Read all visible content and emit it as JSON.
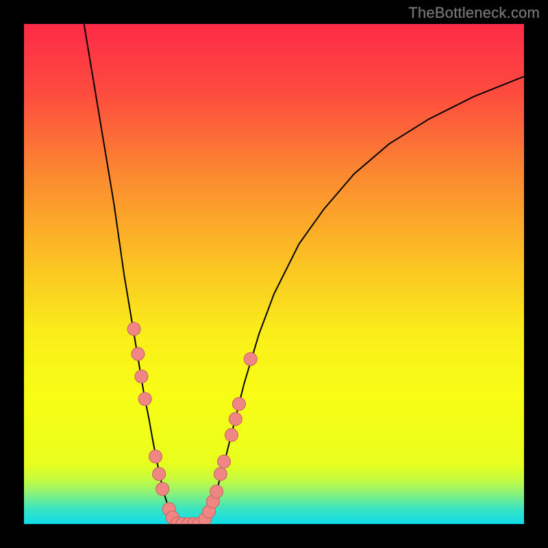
{
  "watermark": "TheBottleneck.com",
  "colors": {
    "frame": "#000000",
    "curve": "#000000",
    "marker_fill": "#ef8683",
    "marker_stroke": "#c46864"
  },
  "chart_data": {
    "type": "line",
    "title": "",
    "xlabel": "",
    "ylabel": "",
    "xlim": [
      0,
      100
    ],
    "ylim": [
      0,
      100
    ],
    "gradient_stops": [
      {
        "offset": 0,
        "color": "#fd2b47"
      },
      {
        "offset": 14,
        "color": "#fd4c3f"
      },
      {
        "offset": 30,
        "color": "#fc8931"
      },
      {
        "offset": 48,
        "color": "#fbc323"
      },
      {
        "offset": 62,
        "color": "#faee1a"
      },
      {
        "offset": 74,
        "color": "#f8fd16"
      },
      {
        "offset": 83,
        "color": "#effe19"
      },
      {
        "offset": 88,
        "color": "#e7fe1e"
      },
      {
        "offset": 91,
        "color": "#c7fb3e"
      },
      {
        "offset": 93,
        "color": "#a0f565"
      },
      {
        "offset": 95,
        "color": "#6ded94"
      },
      {
        "offset": 97,
        "color": "#39e4c2"
      },
      {
        "offset": 100,
        "color": "#0fdce7"
      }
    ],
    "series": [
      {
        "name": "left-branch",
        "x": [
          12,
          13.5,
          15,
          16.5,
          18,
          19,
          20,
          21,
          22,
          23,
          24,
          25,
          25.8,
          26.6,
          27.4,
          28.2,
          29,
          29.7,
          30.3
        ],
        "y": [
          100,
          91,
          82,
          73,
          64,
          57,
          50,
          44,
          38,
          32,
          26,
          21,
          16.5,
          12.4,
          8.7,
          5.5,
          3.0,
          1.3,
          0.3
        ]
      },
      {
        "name": "valley",
        "x": [
          30.3,
          31,
          32,
          33,
          34,
          35,
          35.7
        ],
        "y": [
          0.3,
          0,
          0,
          0,
          0,
          0,
          0.3
        ]
      },
      {
        "name": "right-branch",
        "x": [
          35.7,
          36.5,
          37.3,
          38.5,
          40,
          42,
          44,
          47,
          50,
          55,
          60,
          66,
          73,
          81,
          90,
          100
        ],
        "y": [
          0.3,
          1.5,
          3.2,
          6.5,
          12,
          20,
          28,
          38,
          46,
          56,
          63,
          70,
          76,
          81,
          85.5,
          89.5
        ]
      }
    ],
    "markers": [
      {
        "x": 22.0,
        "y": 39.0,
        "r": 1.3
      },
      {
        "x": 22.8,
        "y": 34.0,
        "r": 1.3
      },
      {
        "x": 23.5,
        "y": 29.5,
        "r": 1.3
      },
      {
        "x": 24.2,
        "y": 25.0,
        "r": 1.3
      },
      {
        "x": 26.3,
        "y": 13.5,
        "r": 1.3
      },
      {
        "x": 27.0,
        "y": 10.0,
        "r": 1.3
      },
      {
        "x": 27.7,
        "y": 7.0,
        "r": 1.3
      },
      {
        "x": 29.0,
        "y": 3.0,
        "r": 1.3
      },
      {
        "x": 29.7,
        "y": 1.3,
        "r": 1.3
      },
      {
        "x": 30.7,
        "y": 0.1,
        "r": 1.3
      },
      {
        "x": 31.7,
        "y": 0.0,
        "r": 1.3
      },
      {
        "x": 32.9,
        "y": 0.0,
        "r": 1.3
      },
      {
        "x": 34.0,
        "y": 0.0,
        "r": 1.3
      },
      {
        "x": 35.0,
        "y": 0.0,
        "r": 1.3
      },
      {
        "x": 36.2,
        "y": 1.0,
        "r": 1.3
      },
      {
        "x": 37.0,
        "y": 2.5,
        "r": 1.3
      },
      {
        "x": 37.8,
        "y": 4.5,
        "r": 1.3
      },
      {
        "x": 38.5,
        "y": 6.5,
        "r": 1.3
      },
      {
        "x": 39.3,
        "y": 10.0,
        "r": 1.3
      },
      {
        "x": 40.0,
        "y": 12.5,
        "r": 1.3
      },
      {
        "x": 41.5,
        "y": 17.8,
        "r": 1.3
      },
      {
        "x": 42.3,
        "y": 21.0,
        "r": 1.3
      },
      {
        "x": 43.0,
        "y": 24.0,
        "r": 1.3
      },
      {
        "x": 45.3,
        "y": 33.0,
        "r": 1.3
      }
    ]
  }
}
